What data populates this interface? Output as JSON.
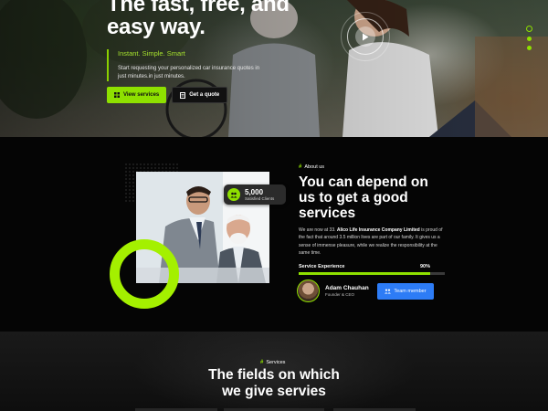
{
  "colors": {
    "accent": "#8ee000",
    "blue": "#2d7cf6",
    "background": "#050505"
  },
  "hero": {
    "title_line1": "The fast, free, and",
    "title_line2": "easy way.",
    "tagline": "Instant. Simple. Smart",
    "description": "Start requesting your personalized car insurance quotes in just minutes.in just minutes.",
    "btn_services": "View services",
    "btn_quote": "Get a quote",
    "slider_dots": 3,
    "play_icon": "play-icon"
  },
  "about": {
    "eyebrow": "About us",
    "title": "You can depend on us to get a good services",
    "desc_before": "We are now at 33. ",
    "desc_company": "Alico Life Insurance Company Limited",
    "desc_after": " is proud of the fact that around 3.5 million lives are part of our family. It gives us a sense of immense pleasure, while we realize the responsibility at the same time.",
    "stats_number": "5,000",
    "stats_label": "Satisfied Clients",
    "skill_label": "Service Experience",
    "skill_value": "90%",
    "skill_percent": 90,
    "author_name": "Adam Chauhan",
    "author_role": "Founder & CEO",
    "team_button": "Team member"
  },
  "services": {
    "eyebrow": "Services",
    "title_line1": "The fields on which",
    "title_line2": "we give servies"
  }
}
